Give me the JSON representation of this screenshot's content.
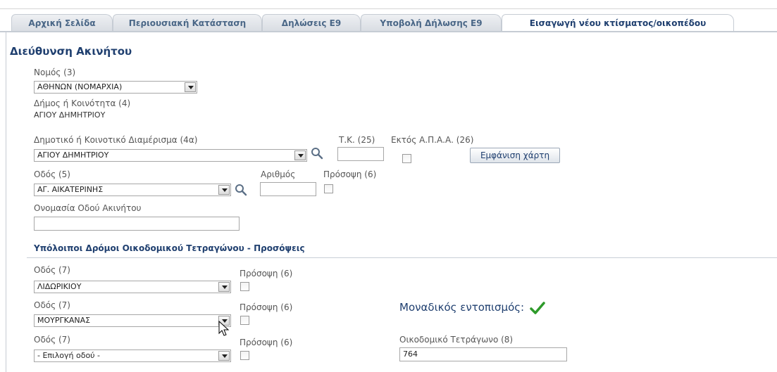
{
  "tabs": [
    "Αρχική Σελίδα",
    "Περιουσιακή Κατάσταση",
    "Δηλώσεις Ε9",
    "Υποβολή Δήλωσης Ε9",
    "Εισαγωγή νέου κτίσματος/οικοπέδου"
  ],
  "section_title": "Διεύθυνση Ακινήτου",
  "nomos": {
    "label": "Νομός (3)",
    "value": "ΑΘΗΝΩΝ (ΝΟΜΑΡΧΙΑ)"
  },
  "dimos": {
    "label": "Δήμος ή Κοινότητα (4)",
    "value": "ΑΓΙΟΥ ΔΗΜΗΤΡΙΟΥ"
  },
  "diamerisma": {
    "label": "Δημοτικό ή Κοινοτικό Διαμέρισμα (4α)",
    "value": "ΑΓΙΟΥ ΔΗΜΗΤΡΙΟΥ"
  },
  "tk": {
    "label": "Τ.Κ. (25)",
    "value": ""
  },
  "ektos": {
    "label": "Εκτός Α.Π.Α.Α. (26)"
  },
  "map_button": "Εμφάνιση χάρτη",
  "odos": {
    "label": "Οδός (5)",
    "value": "ΑΓ. ΑΙΚΑΤΕΡΙΝΗΣ"
  },
  "arithmos": {
    "label": "Αριθμός",
    "value": ""
  },
  "prosopsi_main": {
    "label": "Πρόσοψη (6)"
  },
  "onomasia": {
    "label": "Ονομασία Οδού Ακινήτου",
    "value": ""
  },
  "other_streets_title": "Υπόλοιποι Δρόμοι Οικοδομικού Τετραγώνου - Προσόψεις",
  "other_streets": [
    {
      "label": "Οδός (7)",
      "value": "ΛΙΔΩΡΙΚΙΟΥ",
      "prosopsi": "Πρόσοψη (6)"
    },
    {
      "label": "Οδός (7)",
      "value": "ΜΟΥΡΓΚΑΝΑΣ",
      "prosopsi": "Πρόσοψη (6)"
    },
    {
      "label": "Οδός (7)",
      "value": "- Επιλογή οδού -",
      "prosopsi": "Πρόσοψη (6)"
    }
  ],
  "unique_location": "Μοναδικός εντοπισμός:",
  "block": {
    "label": "Οικοδομικό Τετράγωνο (8)",
    "value": "764"
  },
  "colors": {
    "accent": "#1f3f6f",
    "tab_text": "#4a6787",
    "ok": "#2e9a2a"
  }
}
